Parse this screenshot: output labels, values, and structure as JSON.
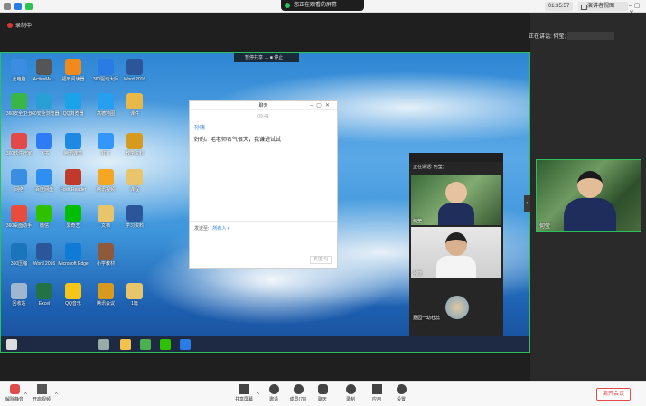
{
  "topbar": {
    "share_banner": "您正在观看的屏幕",
    "timer": "01:35:57",
    "view_label": "演讲者视图",
    "window_controls": "–  ▢  ✕"
  },
  "stage": {
    "recording_label": "录制中",
    "speaking_label": "正在讲话: 何莹;"
  },
  "shared_toolbar": "暂停共享  …  ■ 停止",
  "desktop_icons": [
    {
      "label": "此电脑",
      "color": "#3a8de0"
    },
    {
      "label": "ActiveMe...",
      "color": "#555"
    },
    {
      "label": "福昕阅读器",
      "color": "#f08a1c"
    },
    {
      "label": "360驱动大师",
      "color": "#2a7be4"
    },
    {
      "label": "Word 2016",
      "color": "#2b579a"
    },
    {
      "label": "360安全卫士",
      "color": "#39b54a"
    },
    {
      "label": "360安全浏览器",
      "color": "#2a9fd6"
    },
    {
      "label": "QQ浏览器",
      "color": "#1aa3e8"
    },
    {
      "label": "高德地图",
      "color": "#25a0f0"
    },
    {
      "label": "课件",
      "color": "#e8b84a"
    },
    {
      "label": "360软件管家",
      "color": "#e24a4a"
    },
    {
      "label": "飞书",
      "color": "#2d7cf6"
    },
    {
      "label": "腾讯课堂",
      "color": "#1e88e5"
    },
    {
      "label": "钉钉",
      "color": "#3296fa"
    },
    {
      "label": "教学资料",
      "color": "#d89a1e"
    },
    {
      "label": "网络",
      "color": "#3a8de0"
    },
    {
      "label": "百度网盘",
      "color": "#2e8ff0"
    },
    {
      "label": "Foxit Reader",
      "color": "#c0392b"
    },
    {
      "label": "腾讯视频",
      "color": "#f5a623"
    },
    {
      "label": "课程",
      "color": "#e8c46a"
    },
    {
      "label": "360桌面助手",
      "color": "#e74c3c"
    },
    {
      "label": "微信",
      "color": "#2dc100"
    },
    {
      "label": "爱奇艺",
      "color": "#00be06"
    },
    {
      "label": "文档",
      "color": "#e8c46a"
    },
    {
      "label": "学习资料",
      "color": "#2b579a"
    },
    {
      "label": "360压缩",
      "color": "#1b75bb"
    },
    {
      "label": "Word 2016",
      "color": "#2b579a"
    },
    {
      "label": "Microsoft Edge",
      "color": "#0f7bd7"
    },
    {
      "label": "小学教材",
      "color": "#8e5a3a"
    },
    {
      "label": "回收站",
      "color": "#9fb7cf"
    },
    {
      "label": "Excel",
      "color": "#217346"
    },
    {
      "label": "QQ音乐",
      "color": "#f5c518"
    },
    {
      "label": "腾讯会议",
      "color": "#d89a1e"
    },
    {
      "label": "1篇",
      "color": "#e8c46a"
    }
  ],
  "chat": {
    "title": "聊天",
    "time": "09:41",
    "sender": "孙晓",
    "message": "好的。毛老师名气很大，我谦逊试试",
    "send_to_label": "发送至:",
    "send_to_value": "所有人 ▾",
    "send_button": "发送(S)"
  },
  "participant_panel": {
    "speaking_label": "正在讲话: 何莹;",
    "tiles": [
      {
        "name": "何莹"
      },
      {
        "name": "孙晓"
      },
      {
        "name": "嘉园一幼杜蕊"
      }
    ]
  },
  "right_video": {
    "name": "何莹"
  },
  "bottombar": {
    "mute": "解除静音",
    "video": "开启视频",
    "share": "共享屏幕",
    "invite": "邀请",
    "members": "成员(78)",
    "chat": "聊天",
    "record": "录制",
    "apps": "应用",
    "settings": "设置",
    "leave": "离开会议"
  }
}
